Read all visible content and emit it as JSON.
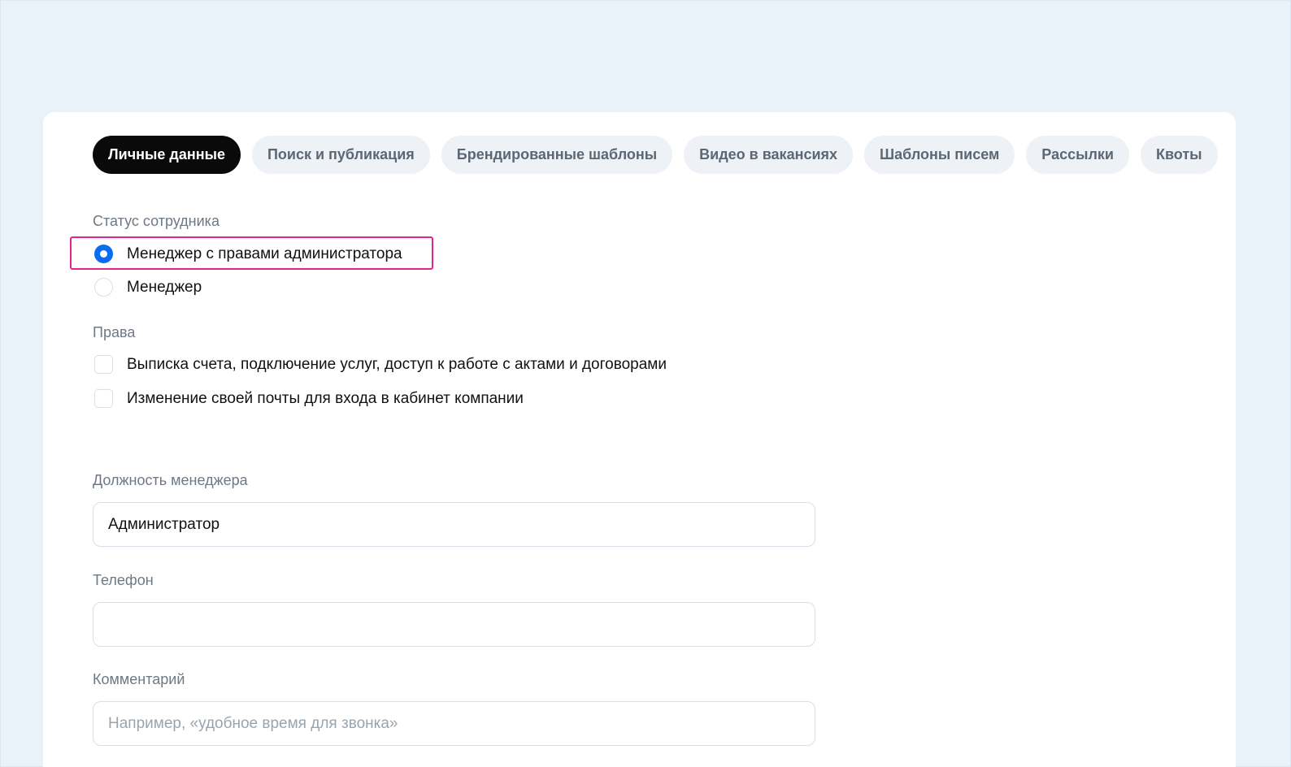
{
  "tabs": [
    {
      "label": "Личные данные",
      "active": true
    },
    {
      "label": "Поиск и публикация",
      "active": false
    },
    {
      "label": "Брендированные шаблоны",
      "active": false
    },
    {
      "label": "Видео в вакансиях",
      "active": false
    },
    {
      "label": "Шаблоны писем",
      "active": false
    },
    {
      "label": "Рассылки",
      "active": false
    },
    {
      "label": "Квоты",
      "active": false
    }
  ],
  "status": {
    "label": "Статус сотрудника",
    "options": [
      {
        "label": "Менеджер с правами администратора",
        "selected": true
      },
      {
        "label": "Менеджер",
        "selected": false
      }
    ]
  },
  "rights": {
    "label": "Права",
    "options": [
      {
        "label": "Выписка счета, подключение услуг, доступ к работе с актами и договорами",
        "checked": false
      },
      {
        "label": "Изменение своей почты для входа в кабинет компании",
        "checked": false
      }
    ]
  },
  "position": {
    "label": "Должность менеджера",
    "value": "Администратор"
  },
  "phone": {
    "label": "Телефон",
    "value": ""
  },
  "comment": {
    "label": "Комментарий",
    "value": "",
    "placeholder": "Например, «удобное время для звонка»"
  },
  "colors": {
    "background": "#eaf2f9",
    "active_tab": "#0a0a0a",
    "radio_selected": "#0b6cf0",
    "highlight": "#e3248f"
  }
}
